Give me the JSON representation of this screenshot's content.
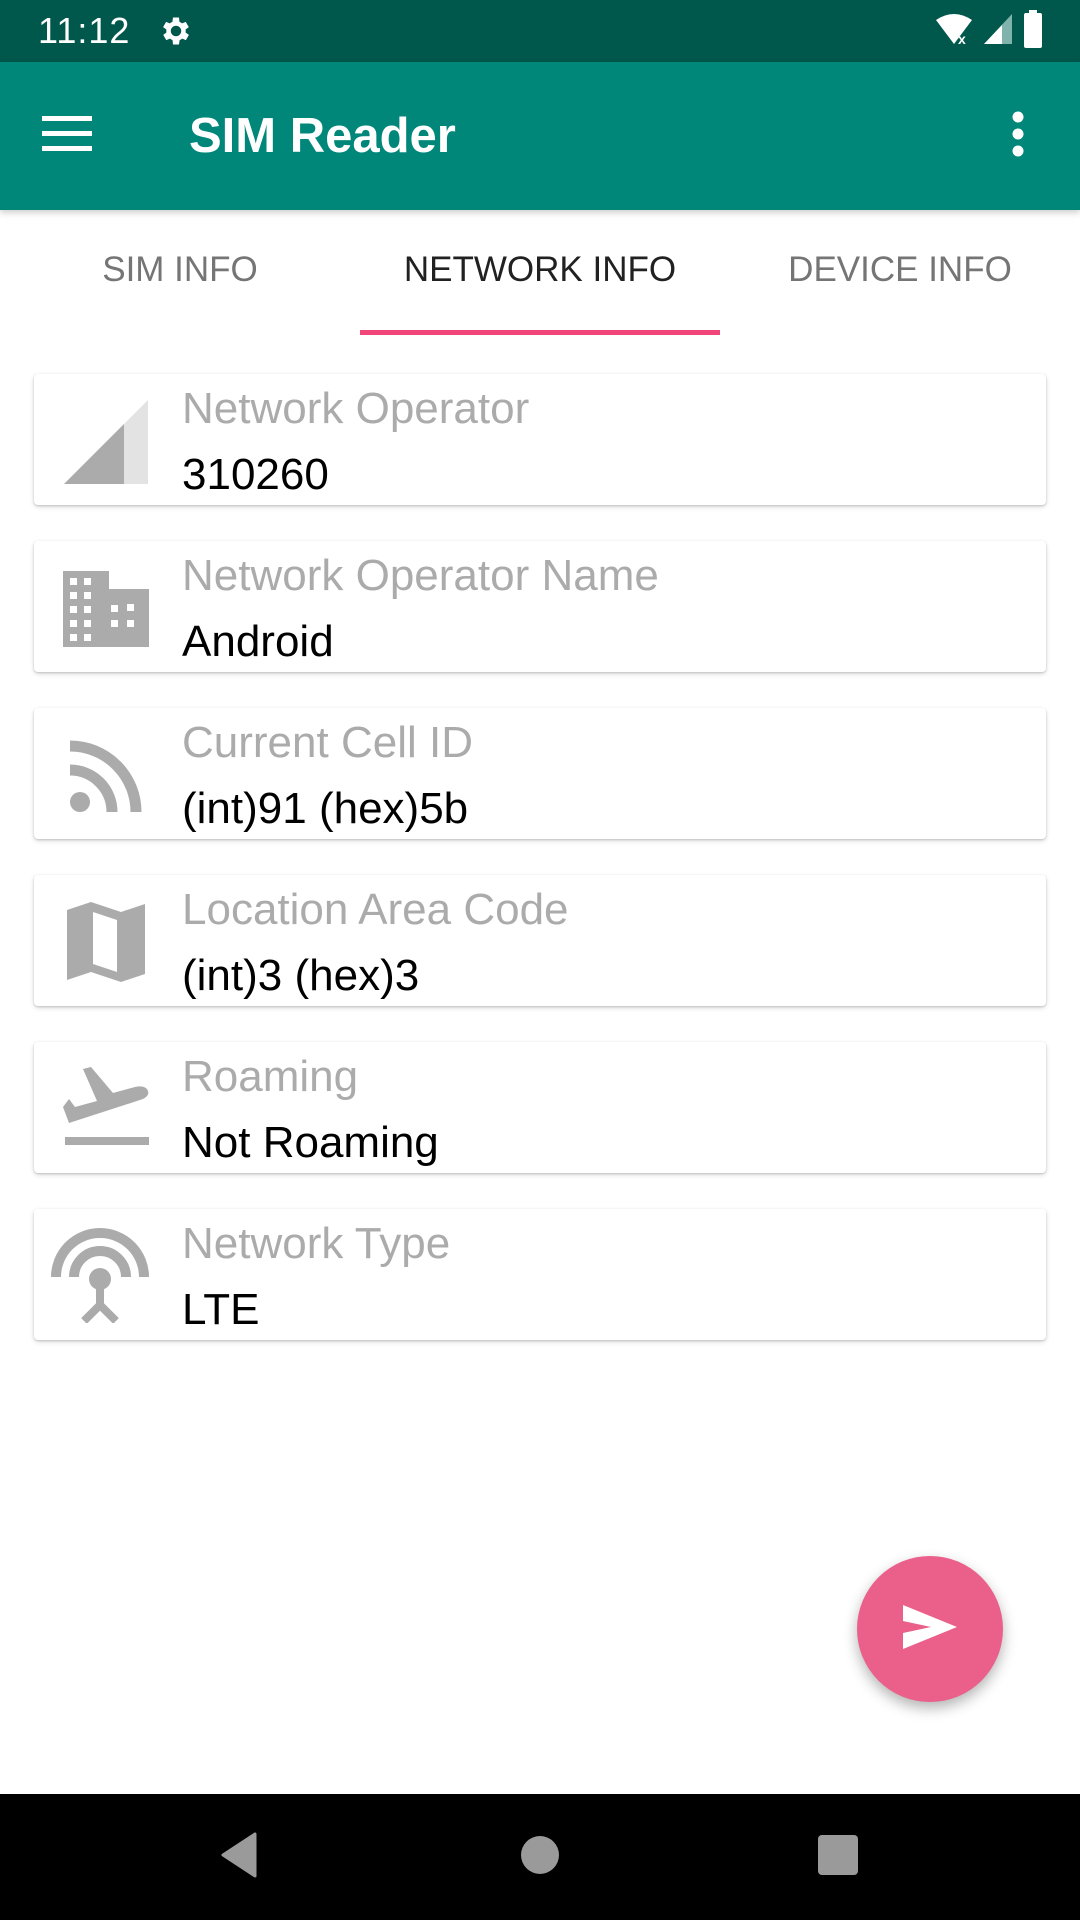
{
  "status_bar": {
    "time": "11:12",
    "icons": [
      "settings-gear-icon",
      "wifi-no-internet-icon",
      "cell-signal-icon",
      "battery-icon"
    ]
  },
  "app_bar": {
    "title": "SIM Reader",
    "left_icon": "menu-icon",
    "right_icon": "more-vert-icon",
    "color": "#00877a",
    "status_color": "#00574b"
  },
  "tabs": {
    "items": [
      {
        "label": "SIM INFO",
        "active": false
      },
      {
        "label": "NETWORK INFO",
        "active": true
      },
      {
        "label": "DEVICE INFO",
        "active": false
      }
    ],
    "indicator_color": "#f1467a"
  },
  "cards": [
    {
      "icon": "signal-cellular-icon",
      "label": "Network Operator",
      "value": "310260"
    },
    {
      "icon": "building-icon",
      "label": "Network Operator Name",
      "value": "Android"
    },
    {
      "icon": "rss-feed-icon",
      "label": "Current Cell ID",
      "value": "(int)91 (hex)5b"
    },
    {
      "icon": "map-icon",
      "label": "Location Area Code",
      "value": "(int)3 (hex)3"
    },
    {
      "icon": "flight-land-icon",
      "label": "Roaming",
      "value": "Not Roaming"
    },
    {
      "icon": "antenna-tower-icon",
      "label": "Network Type",
      "value": "LTE"
    }
  ],
  "fab": {
    "icon": "send-icon",
    "color": "#ea608a"
  },
  "nav_bar": {
    "buttons": [
      "back-icon",
      "home-icon",
      "recents-icon"
    ]
  }
}
